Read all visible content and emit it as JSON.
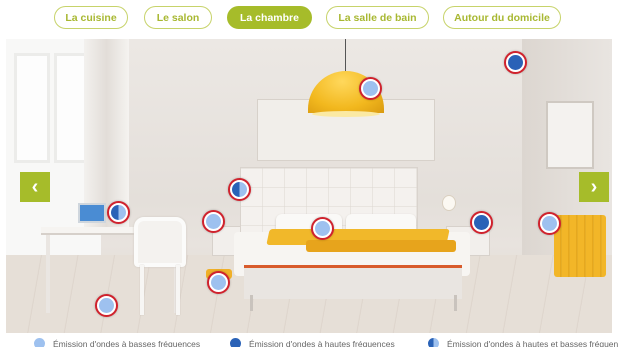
{
  "tabs": [
    {
      "label": "La cuisine",
      "active": false
    },
    {
      "label": "Le salon",
      "active": false
    },
    {
      "label": "La chambre",
      "active": true
    },
    {
      "label": "La salle de bain",
      "active": false
    },
    {
      "label": "Autour du domicile",
      "active": false
    }
  ],
  "navigation": {
    "prev_icon": "chevron-left-icon",
    "prev_glyph": "‹",
    "next_icon": "chevron-right-icon",
    "next_glyph": "›"
  },
  "hotspots": [
    {
      "id": "ceiling-corner",
      "type": "high"
    },
    {
      "id": "pendant-lamp",
      "type": "low"
    },
    {
      "id": "left-bedside-lamp",
      "type": "both"
    },
    {
      "id": "laptop",
      "type": "both"
    },
    {
      "id": "left-nightstand",
      "type": "low"
    },
    {
      "id": "bed",
      "type": "low"
    },
    {
      "id": "right-nightstand-device",
      "type": "high"
    },
    {
      "id": "wall-socket",
      "type": "low"
    },
    {
      "id": "floor-heater",
      "type": "low"
    },
    {
      "id": "floor-under-desk",
      "type": "low"
    }
  ],
  "legend": [
    {
      "type": "low",
      "label": "Émission d'ondes à basses fréquences"
    },
    {
      "type": "high",
      "label": "Émission d'ondes à hautes fréquences"
    },
    {
      "type": "both",
      "label": "Émission d'ondes à hautes et basses fréquences"
    }
  ],
  "colors": {
    "accent": "#a6bc2a",
    "hotspot_border": "#d0222d",
    "low_freq": "#9ec1ef",
    "high_freq": "#2a62b7",
    "lamp_yellow": "#f2b81e"
  }
}
